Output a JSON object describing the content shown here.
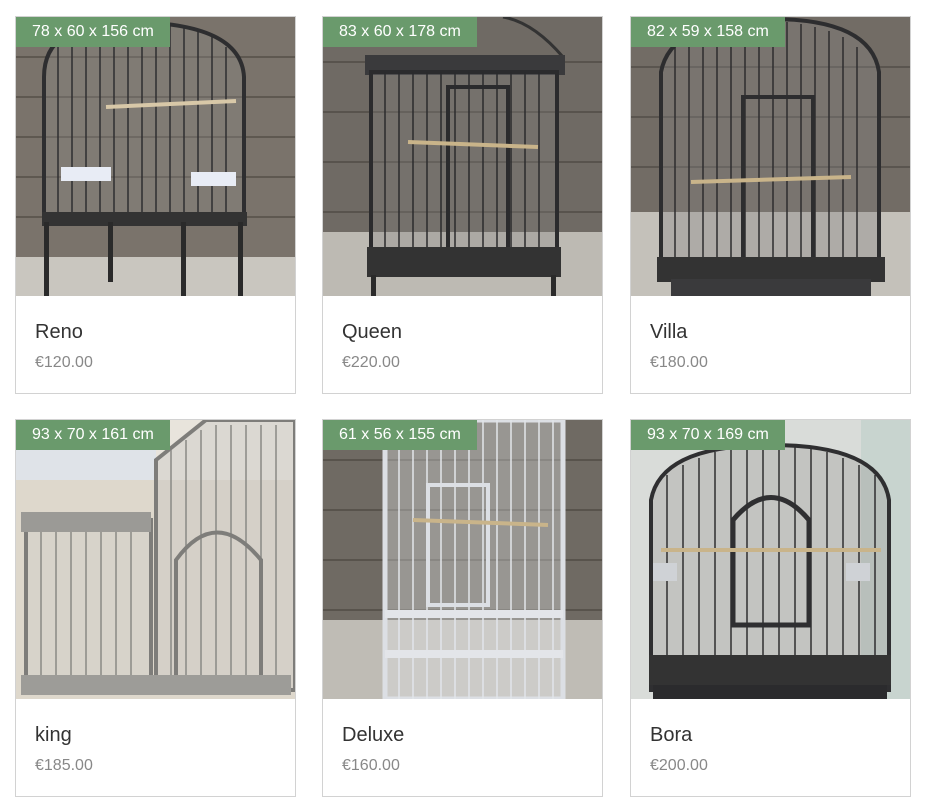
{
  "products": [
    {
      "dimensions": "78 x 60 x 156 cm",
      "name": "Reno",
      "price": "€120.00",
      "photo": "dark-grey-parrot-cage-domed-top-on-stand"
    },
    {
      "dimensions": "83 x 60 x 178 cm",
      "name": "Queen",
      "price": "€220.00",
      "photo": "dark-grey-parrot-cage-open-top"
    },
    {
      "dimensions": "82 x 59 x 158 cm",
      "name": "Villa",
      "price": "€180.00",
      "photo": "dark-grey-parrot-cage-domed-top"
    },
    {
      "dimensions": "93 x 70 x 161 cm",
      "name": "king",
      "price": "€185.00",
      "photo": "silver-parrot-cage-gable-top-with-side-tray"
    },
    {
      "dimensions": "61 x 56 x 155 cm",
      "name": "Deluxe",
      "price": "€160.00",
      "photo": "white-tall-parrot-cage"
    },
    {
      "dimensions": "93 x 70 x 169 cm",
      "name": "Bora",
      "price": "€200.00",
      "photo": "dark-grey-parrot-cage-domed-top-wide"
    }
  ],
  "colors": {
    "badge": "#6a9a6c",
    "name_text": "#333333",
    "price_text": "#888888",
    "card_border": "#d2d2d2"
  }
}
